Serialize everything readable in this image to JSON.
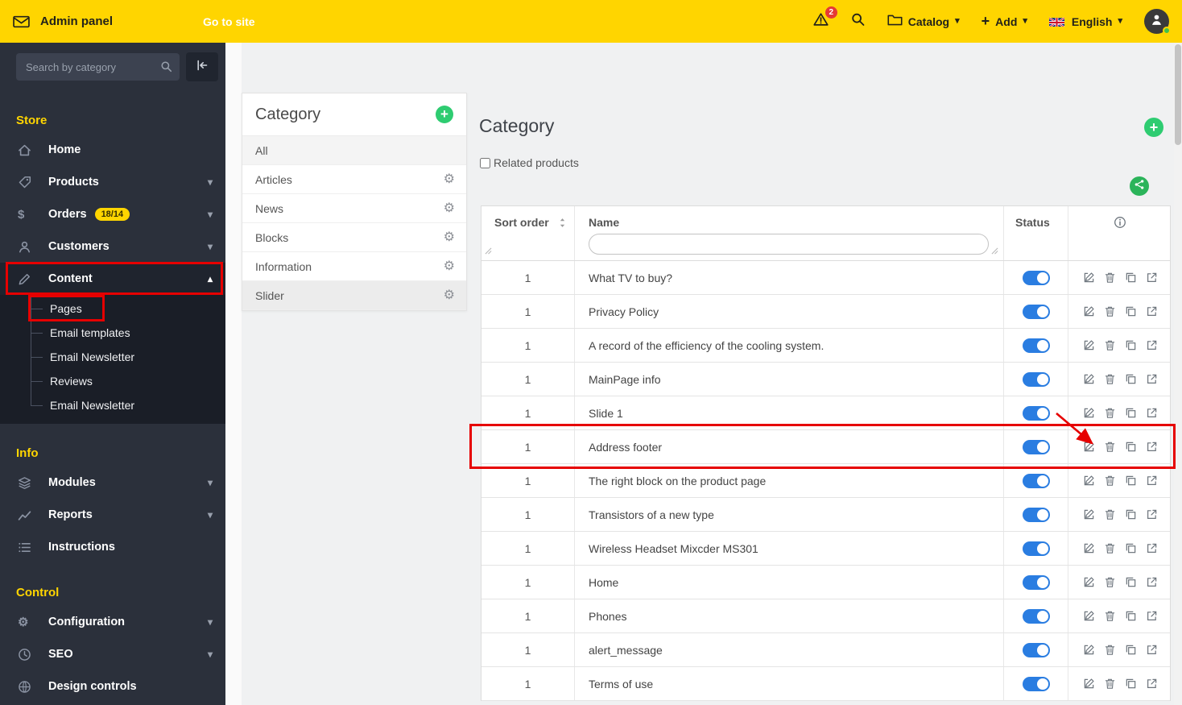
{
  "colors": {
    "accent_yellow": "#ffd500",
    "sidebar_bg": "#2b303b",
    "toggle_on_blue": "#2a7de1",
    "green": "#2ecc71",
    "annotation_red": "#e60000",
    "badge_red": "#e53935"
  },
  "topbar": {
    "brand": "Admin panel",
    "go_to_site": "Go to site",
    "notifications_count": "2",
    "menus": {
      "catalog": "Catalog",
      "add": "Add",
      "language": "English"
    }
  },
  "sidebar": {
    "search_placeholder": "Search by category",
    "groups": [
      {
        "label": "Store",
        "items": [
          {
            "label": "Home",
            "icon": "home"
          },
          {
            "label": "Products",
            "icon": "tag",
            "chevron": "down"
          },
          {
            "label": "Orders",
            "icon": "dollar",
            "badge": "18/14",
            "chevron": "down"
          },
          {
            "label": "Customers",
            "icon": "user",
            "chevron": "down"
          },
          {
            "label": "Content",
            "icon": "pencil",
            "chevron": "up",
            "active": true,
            "children": [
              "Pages",
              "Email templates",
              "Email Newsletter",
              "Reviews",
              "Email Newsletter"
            ]
          }
        ]
      },
      {
        "label": "Info",
        "items": [
          {
            "label": "Modules",
            "icon": "layers",
            "chevron": "down"
          },
          {
            "label": "Reports",
            "icon": "chart",
            "chevron": "down"
          },
          {
            "label": "Instructions",
            "icon": "list"
          }
        ]
      },
      {
        "label": "Control",
        "items": [
          {
            "label": "Configuration",
            "icon": "gear",
            "chevron": "down"
          },
          {
            "label": "SEO",
            "icon": "seo",
            "chevron": "down"
          },
          {
            "label": "Design controls",
            "icon": "globe"
          }
        ]
      }
    ]
  },
  "category_panel": {
    "title": "Category",
    "items": [
      {
        "label": "All",
        "selected": true,
        "gear": false
      },
      {
        "label": "Articles",
        "gear": true
      },
      {
        "label": "News",
        "gear": true
      },
      {
        "label": "Blocks",
        "gear": true
      },
      {
        "label": "Information",
        "gear": true
      },
      {
        "label": "Slider",
        "gear": true,
        "shaded": true
      }
    ]
  },
  "content": {
    "title": "Category",
    "related_products_label": "Related products",
    "table": {
      "headers": {
        "sort": "Sort order",
        "name": "Name",
        "status": "Status"
      },
      "name_filter_value": "",
      "row_actions": [
        "edit",
        "trash",
        "copy",
        "export"
      ],
      "rows": [
        {
          "sort": "1",
          "name": "What TV to buy?",
          "status_on": true
        },
        {
          "sort": "1",
          "name": "Privacy Policy",
          "status_on": true
        },
        {
          "sort": "1",
          "name": "A record of the efficiency of the cooling system.",
          "status_on": true
        },
        {
          "sort": "1",
          "name": "MainPage info",
          "status_on": true
        },
        {
          "sort": "1",
          "name": "Slide 1",
          "status_on": true
        },
        {
          "sort": "1",
          "name": "Address footer",
          "status_on": true,
          "annotated": true
        },
        {
          "sort": "1",
          "name": "The right block on the product page",
          "status_on": true
        },
        {
          "sort": "1",
          "name": "Transistors of a new type",
          "status_on": true
        },
        {
          "sort": "1",
          "name": "Wireless Headset Mixcder MS301",
          "status_on": true
        },
        {
          "sort": "1",
          "name": "Home",
          "status_on": true
        },
        {
          "sort": "1",
          "name": "Phones",
          "status_on": true
        },
        {
          "sort": "1",
          "name": "alert_message",
          "status_on": true
        },
        {
          "sort": "1",
          "name": "Terms of use",
          "status_on": true
        }
      ]
    }
  },
  "annotations": {
    "highlighted_sidebar_item": "Content",
    "highlighted_sidebar_subitem": "Pages",
    "highlighted_row": "Address footer"
  }
}
